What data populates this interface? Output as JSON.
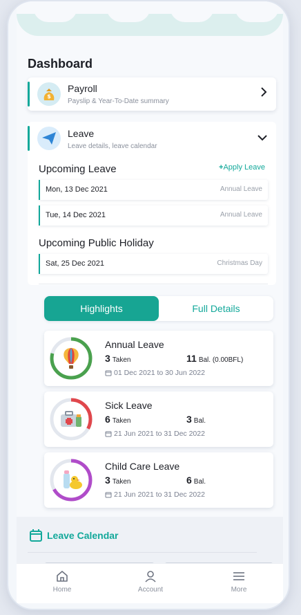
{
  "page": {
    "title": "Dashboard"
  },
  "payroll": {
    "title": "Payroll",
    "subtitle": "Payslip & Year-To-Date summary",
    "icon": "money-bag-icon"
  },
  "leave": {
    "title": "Leave",
    "subtitle": "Leave details, leave calendar",
    "icon": "paper-plane-icon",
    "upcoming_title": "Upcoming Leave",
    "apply_label": "Apply Leave",
    "upcoming": [
      {
        "date": "Mon, 13 Dec 2021",
        "type": "Annual Leave"
      },
      {
        "date": "Tue, 14 Dec 2021",
        "type": "Annual Leave"
      }
    ],
    "holiday_title": "Upcoming Public Holiday",
    "holidays": [
      {
        "date": "Sat, 25 Dec 2021",
        "name": "Christmas Day"
      }
    ]
  },
  "tabs": {
    "highlights": "Highlights",
    "full_details": "Full Details"
  },
  "highlights": [
    {
      "name": "Annual Leave",
      "taken": "3",
      "taken_label": "Taken",
      "bal": "11",
      "bal_label": "Bal. (0.00BFL)",
      "range": "01 Dec 2021 to 30 Jun 2022",
      "ring_color": "#4aa14e",
      "progress": 0.79,
      "icon": "hot-air-balloon-icon"
    },
    {
      "name": "Sick Leave",
      "taken": "6",
      "taken_label": "Taken",
      "bal": "3",
      "bal_label": "Bal.",
      "range": "21 Jun 2021 to 31 Dec 2022",
      "ring_color": "#e0474c",
      "progress": 0.33,
      "icon": "first-aid-kit-icon"
    },
    {
      "name": "Child Care Leave",
      "taken": "3",
      "taken_label": "Taken",
      "bal": "6",
      "bal_label": "Bal.",
      "range": "21 Jun 2021 to 31 Dec 2022",
      "ring_color": "#b04cc9",
      "progress": 0.67,
      "icon": "baby-bottle-duck-icon"
    }
  ],
  "calendar": {
    "title": "Leave Calendar"
  },
  "nav": {
    "home": "Home",
    "account": "Account",
    "more": "More"
  },
  "colors": {
    "accent": "#12a89a",
    "tab_active": "#17a593"
  }
}
